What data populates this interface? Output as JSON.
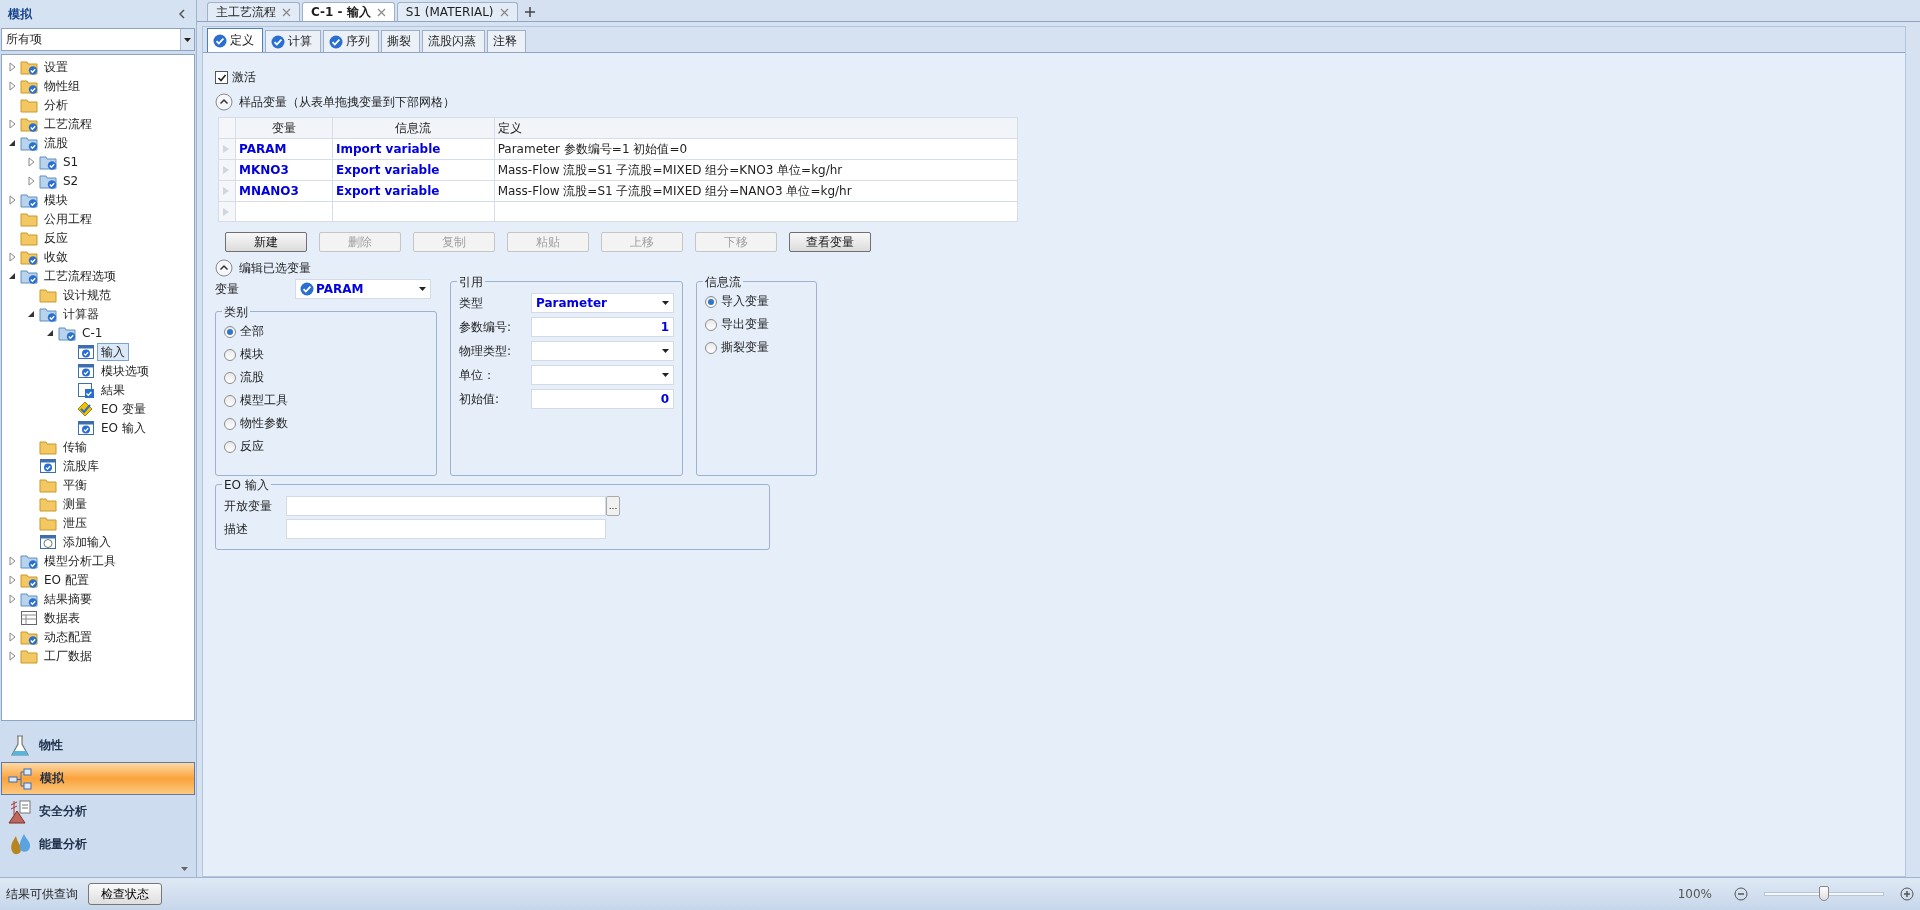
{
  "sidebar": {
    "title": "模拟",
    "filter": "所有项",
    "tree": [
      {
        "label": "设置",
        "kind": "folder-done",
        "expandable": true,
        "expanded": false,
        "selected": false
      },
      {
        "label": "物性组",
        "kind": "folder-done",
        "expandable": true,
        "expanded": false,
        "selected": false
      },
      {
        "label": "分析",
        "kind": "folder",
        "expandable": false,
        "expanded": false,
        "selected": false
      },
      {
        "label": "工艺流程",
        "kind": "folder-done",
        "expandable": true,
        "expanded": false,
        "selected": false
      },
      {
        "label": "流股",
        "kind": "folder-blue",
        "expandable": true,
        "expanded": true,
        "selected": false,
        "children": [
          {
            "label": "S1",
            "kind": "folder-blue",
            "expandable": true,
            "expanded": false,
            "selected": false
          },
          {
            "label": "S2",
            "kind": "folder-blue",
            "expandable": true,
            "expanded": false,
            "selected": false
          }
        ]
      },
      {
        "label": "模块",
        "kind": "folder-blue",
        "expandable": true,
        "expanded": false,
        "selected": false
      },
      {
        "label": "公用工程",
        "kind": "folder",
        "expandable": false,
        "expanded": false,
        "selected": false
      },
      {
        "label": "反应",
        "kind": "folder",
        "expandable": false,
        "expanded": false,
        "selected": false
      },
      {
        "label": "收敛",
        "kind": "folder-done",
        "expandable": true,
        "expanded": false,
        "selected": false
      },
      {
        "label": "工艺流程选项",
        "kind": "folder-blue",
        "expandable": true,
        "expanded": true,
        "selected": false,
        "children": [
          {
            "label": "设计规范",
            "kind": "folder",
            "expandable": false,
            "expanded": false,
            "selected": false
          },
          {
            "label": "计算器",
            "kind": "folder-blue",
            "expandable": true,
            "expanded": true,
            "selected": false,
            "children": [
              {
                "label": "C-1",
                "kind": "folder-blue",
                "expandable": true,
                "expanded": true,
                "selected": false,
                "children": [
                  {
                    "label": "输入",
                    "kind": "form-done",
                    "expandable": false,
                    "expanded": false,
                    "selected": true
                  },
                  {
                    "label": "模块选项",
                    "kind": "form-done",
                    "expandable": false,
                    "expanded": false,
                    "selected": false
                  },
                  {
                    "label": "結果",
                    "kind": "form-results",
                    "expandable": false,
                    "expanded": false,
                    "selected": false
                  },
                  {
                    "label": "EO 变量",
                    "kind": "form-eo",
                    "expandable": false,
                    "expanded": false,
                    "selected": false
                  },
                  {
                    "label": "EO 输入",
                    "kind": "form-done",
                    "expandable": false,
                    "expanded": false,
                    "selected": false
                  }
                ]
              }
            ]
          },
          {
            "label": "传输",
            "kind": "folder",
            "expandable": false,
            "expanded": false,
            "selected": false
          },
          {
            "label": "流股库",
            "kind": "form-done",
            "expandable": false,
            "expanded": false,
            "selected": false
          },
          {
            "label": "平衡",
            "kind": "folder",
            "expandable": false,
            "expanded": false,
            "selected": false
          },
          {
            "label": "测量",
            "kind": "folder",
            "expandable": false,
            "expanded": false,
            "selected": false
          },
          {
            "label": "泄压",
            "kind": "folder",
            "expandable": false,
            "expanded": false,
            "selected": false
          },
          {
            "label": "添加输入",
            "kind": "form-empty",
            "expandable": false,
            "expanded": false,
            "selected": false
          }
        ]
      },
      {
        "label": "模型分析工具",
        "kind": "folder-blue",
        "expandable": true,
        "expanded": false,
        "selected": false
      },
      {
        "label": "EO 配置",
        "kind": "folder-done",
        "expandable": true,
        "expanded": false,
        "selected": false
      },
      {
        "label": "結果摘要",
        "kind": "folder-blue",
        "expandable": true,
        "expanded": false,
        "selected": false
      },
      {
        "label": "数据表",
        "kind": "table",
        "expandable": false,
        "expanded": false,
        "selected": false
      },
      {
        "label": "动态配置",
        "kind": "folder-done",
        "expandable": true,
        "expanded": false,
        "selected": false
      },
      {
        "label": "工厂数据",
        "kind": "folder",
        "expandable": true,
        "expanded": false,
        "selected": false
      }
    ],
    "nav": [
      {
        "label": "物性",
        "kind": "flask",
        "selected": false
      },
      {
        "label": "模拟",
        "kind": "flowsheet",
        "selected": true
      },
      {
        "label": "安全分析",
        "kind": "safety",
        "selected": false
      },
      {
        "label": "能量分析",
        "kind": "energy",
        "selected": false
      }
    ]
  },
  "doc_tabs": [
    {
      "label": "主工艺流程",
      "selected": false
    },
    {
      "label": "C-1 - 输入",
      "selected": true
    },
    {
      "label": "S1 (MATERIAL)",
      "selected": false
    }
  ],
  "form_tabs": [
    {
      "label": "定义",
      "complete": true,
      "selected": true
    },
    {
      "label": "计算",
      "complete": true,
      "selected": false
    },
    {
      "label": "序列",
      "complete": true,
      "selected": false
    },
    {
      "label": "撕裂",
      "complete": false,
      "selected": false
    },
    {
      "label": "流股闪蒸",
      "complete": false,
      "selected": false
    },
    {
      "label": "注释",
      "complete": false,
      "selected": false
    }
  ],
  "active": {
    "label": "激活",
    "checked": true
  },
  "sampled": {
    "title": "样品变量（从表单拖拽变量到下部网格）",
    "expanded": true,
    "columns": [
      "变量",
      "信息流",
      "定义"
    ],
    "rows": [
      [
        "PARAM",
        "Import variable",
        "Parameter 参数编号=1 初始值=0"
      ],
      [
        "MKNO3",
        "Export variable",
        "Mass-Flow 流股=S1 子流股=MIXED 组分=KNO3 单位=kg/hr"
      ],
      [
        "MNANO3",
        "Export variable",
        "Mass-Flow 流股=S1 子流股=MIXED 组分=NANO3 单位=kg/hr"
      ]
    ],
    "buttons": [
      {
        "label": "新建",
        "disabled": false
      },
      {
        "label": "删除",
        "disabled": true
      },
      {
        "label": "复制",
        "disabled": true
      },
      {
        "label": "粘贴",
        "disabled": true
      },
      {
        "label": "上移",
        "disabled": true
      },
      {
        "label": "下移",
        "disabled": true
      },
      {
        "label": "查看变量",
        "disabled": false
      }
    ]
  },
  "edit": {
    "title": "编辑已选变量",
    "expanded": true,
    "variable_label": "变量",
    "variable_value": "PARAM",
    "category": {
      "title": "类别",
      "options": [
        {
          "label": "全部",
          "selected": true
        },
        {
          "label": "模块",
          "selected": false
        },
        {
          "label": "流股",
          "selected": false
        },
        {
          "label": "模型工具",
          "selected": false
        },
        {
          "label": "物性参数",
          "selected": false
        },
        {
          "label": "反应",
          "selected": false
        }
      ]
    },
    "reference": {
      "title": "引用",
      "fields": [
        {
          "label": "类型",
          "kind": "dropdown",
          "value": "Parameter"
        },
        {
          "label": "参数编号:",
          "kind": "number",
          "value": "1"
        },
        {
          "label": "物理类型:",
          "kind": "dropdown"
        },
        {
          "label": "单位：",
          "kind": "dropdown"
        },
        {
          "label": "初始值:",
          "kind": "number",
          "value": "0"
        }
      ]
    },
    "flow": {
      "title": "信息流",
      "options": [
        {
          "label": "导入变量",
          "selected": true
        },
        {
          "label": "导出变量",
          "selected": false
        },
        {
          "label": "撕裂变量",
          "selected": false
        }
      ]
    },
    "eo": {
      "title": "EO 输入",
      "open_label": "开放变量",
      "browse": "...",
      "desc_label": "描述"
    }
  },
  "status_bar": {
    "message": "结果可供查询",
    "button": "检查状态",
    "zoom": "100%",
    "level": 0.5
  }
}
